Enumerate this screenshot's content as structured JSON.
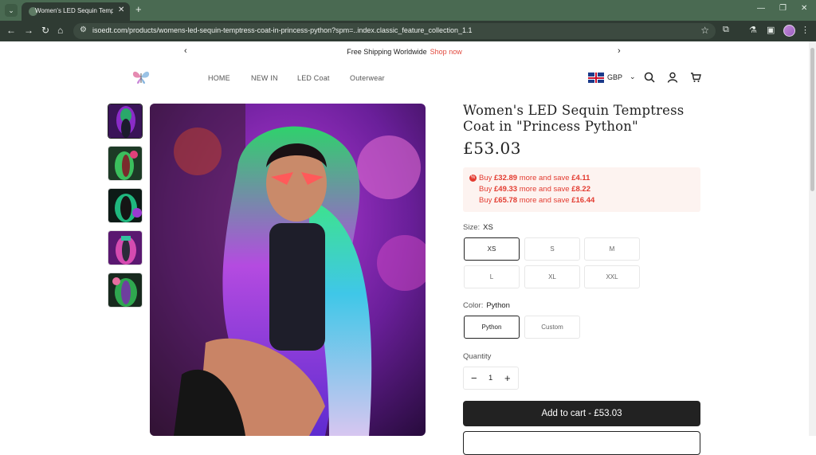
{
  "browser": {
    "tab_title": "Women's LED Sequin Temptress",
    "url": "isoedt.com/products/womens-led-sequin-temptress-coat-in-princess-python?spm=..index.classic_feature_collection_1.1"
  },
  "announcement": {
    "text": "Free Shipping Worldwide",
    "link": "Shop now"
  },
  "nav": {
    "items": [
      "HOME",
      "NEW IN",
      "LED Coat",
      "Outerwear"
    ],
    "currency": "GBP"
  },
  "product": {
    "title": "Women's LED Sequin Temptress Coat in \"Princess Python\"",
    "price": "£53.03",
    "promos": [
      {
        "prefix": "Buy",
        "amount": "£32.89",
        "middle": "more and save",
        "save": "£4.11"
      },
      {
        "prefix": "Buy",
        "amount": "£49.33",
        "middle": "more and save",
        "save": "£8.22"
      },
      {
        "prefix": "Buy",
        "amount": "£65.78",
        "middle": "more and save",
        "save": "£16.44"
      }
    ],
    "size_label": "Size:",
    "size_value": "XS",
    "sizes": [
      "XS",
      "S",
      "M",
      "L",
      "XL",
      "XXL"
    ],
    "color_label": "Color:",
    "color_value": "Python",
    "colors": [
      "Python",
      "Custom"
    ],
    "quantity_label": "Quantity",
    "quantity": "1",
    "add_to_cart": "Add to cart - £53.03"
  },
  "colors": {
    "tabstrip": "#4a6a52",
    "toolbar": "#2f3b33",
    "promo_text": "#e33b30",
    "promo_bg": "#fdf3f0",
    "shop_now": "#e1483c",
    "button_dark": "#222222"
  }
}
